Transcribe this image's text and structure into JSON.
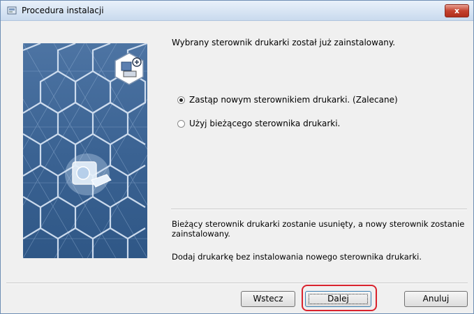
{
  "window": {
    "title": "Procedura instalacji",
    "close_label": "x"
  },
  "main": {
    "message": "Wybrany sterownik drukarki został już zainstalowany."
  },
  "options": [
    {
      "label": "Zastąp nowym sterownikiem drukarki. (Zalecane)",
      "selected": true
    },
    {
      "label": "Użyj bieżącego sterownika drukarki.",
      "selected": false
    }
  ],
  "info": {
    "line1": "Bieżący sterownik drukarki zostanie usunięty, a nowy sterownik zostanie zainstalowany.",
    "line2": "Dodaj drukarkę bez instalowania nowego sterownika drukarki."
  },
  "buttons": {
    "back": "Wstecz",
    "next": "Dalej",
    "cancel": "Anuluj"
  },
  "colors": {
    "art_background": "#3a6292",
    "highlight": "#d9232d"
  }
}
